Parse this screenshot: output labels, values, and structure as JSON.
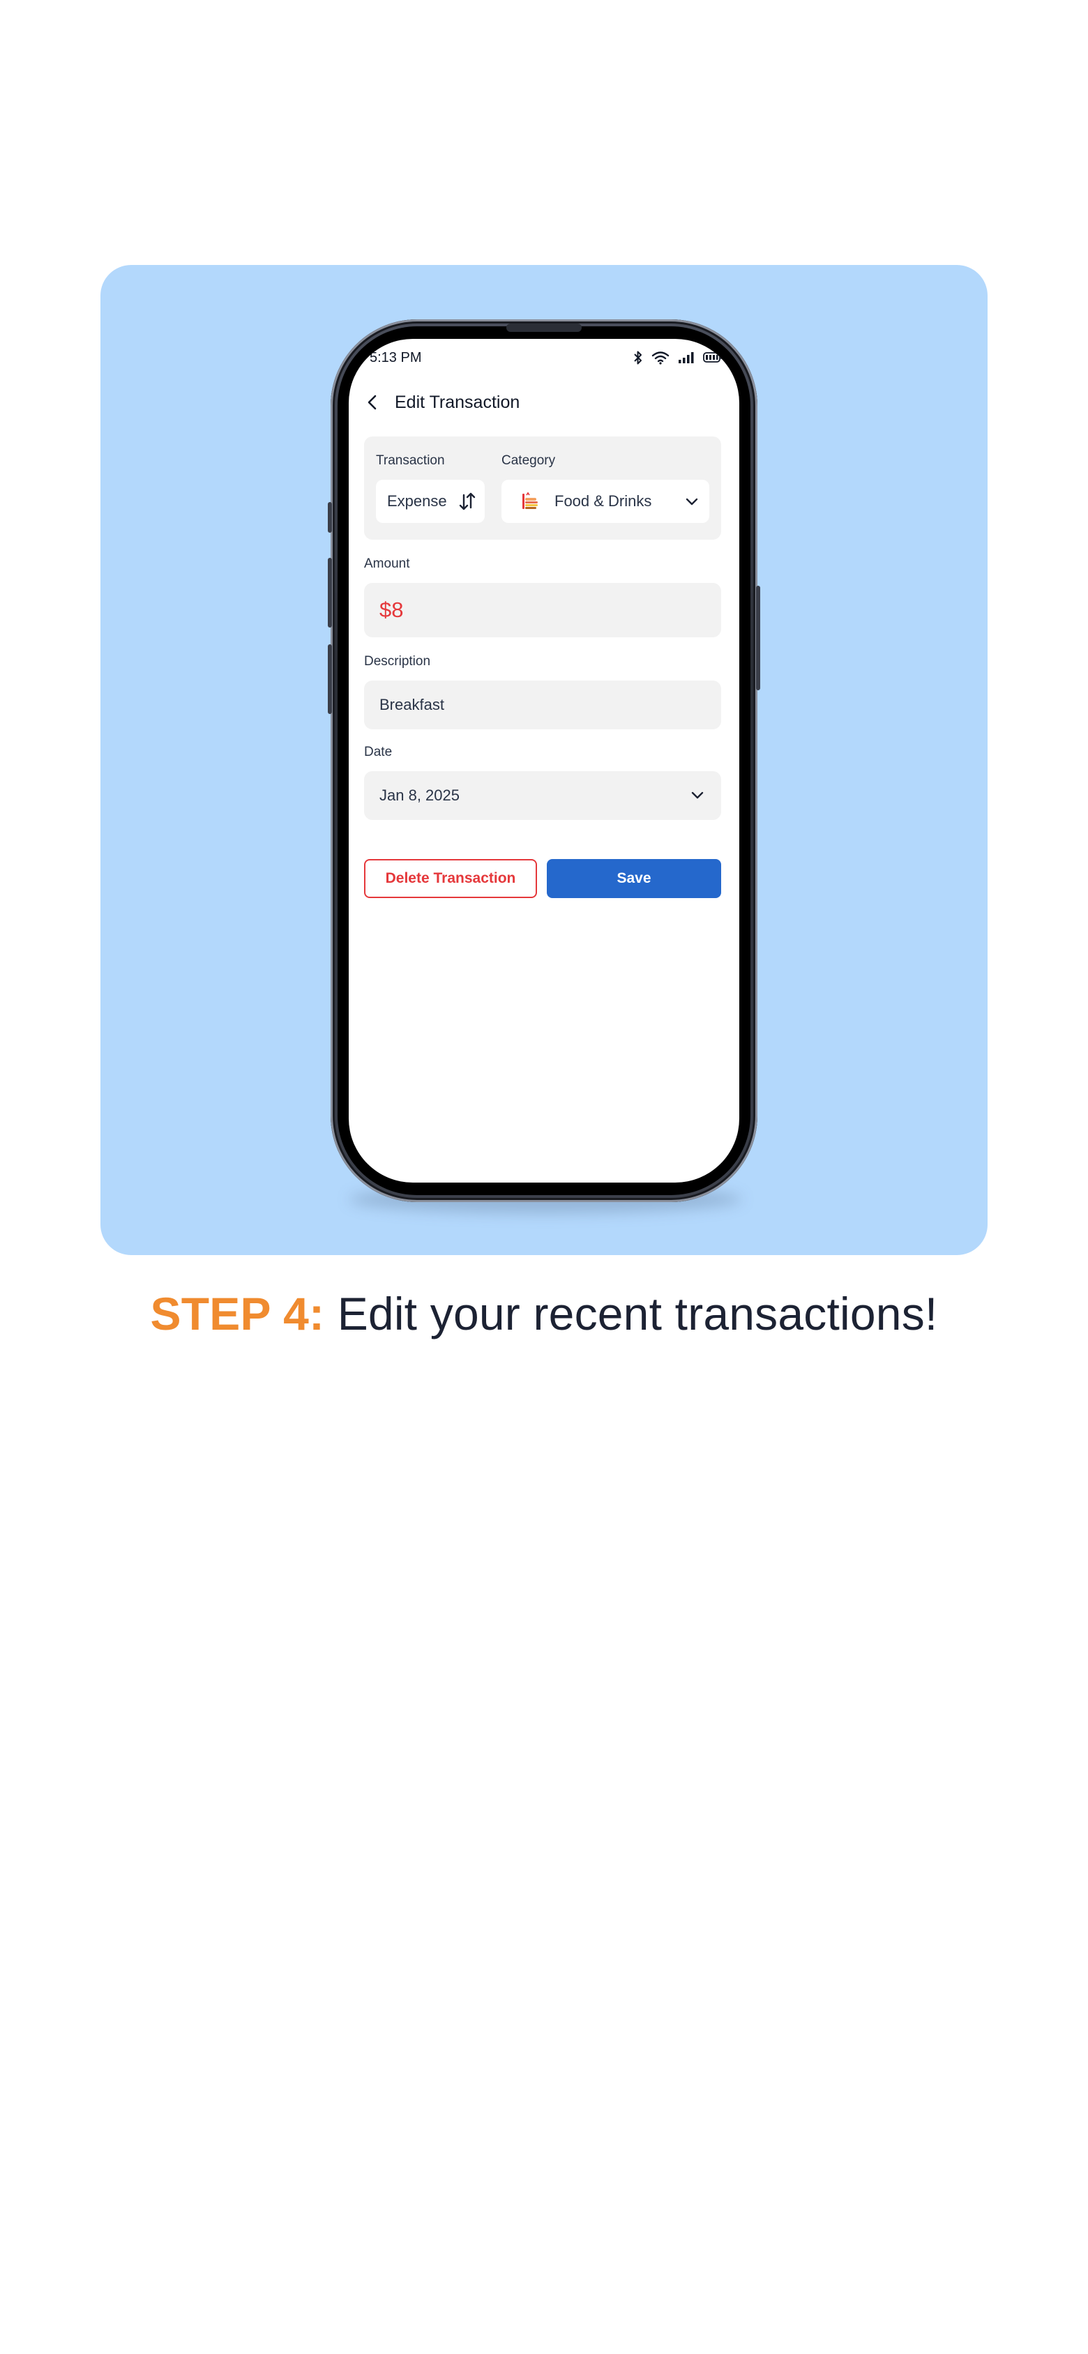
{
  "colors": {
    "card_background": "#b3d8fc",
    "accent_orange": "#f08b2f",
    "expense_red": "#e5383b",
    "primary_blue": "#2568cc",
    "text_dark": "#1c2233"
  },
  "status_bar": {
    "time": "5:13 PM",
    "icons": [
      "bluetooth-icon",
      "wifi-icon",
      "signal-icon",
      "battery-icon"
    ]
  },
  "header": {
    "back_icon": "chevron-left-icon",
    "title": "Edit Transaction"
  },
  "form": {
    "transaction_label": "Transaction",
    "transaction_value": "Expense",
    "transaction_icon": "swap-vertical-icon",
    "category_label": "Category",
    "category_value": "Food & Drinks",
    "category_icon": "food-drinks-icon",
    "amount_label": "Amount",
    "amount_value": "$8",
    "description_label": "Description",
    "description_value": "Breakfast",
    "date_label": "Date",
    "date_value": "Jan 8, 2025"
  },
  "actions": {
    "delete_label": "Delete Transaction",
    "save_label": "Save"
  },
  "caption": {
    "step": "STEP 4:",
    "text": " Edit your recent transactions!"
  }
}
